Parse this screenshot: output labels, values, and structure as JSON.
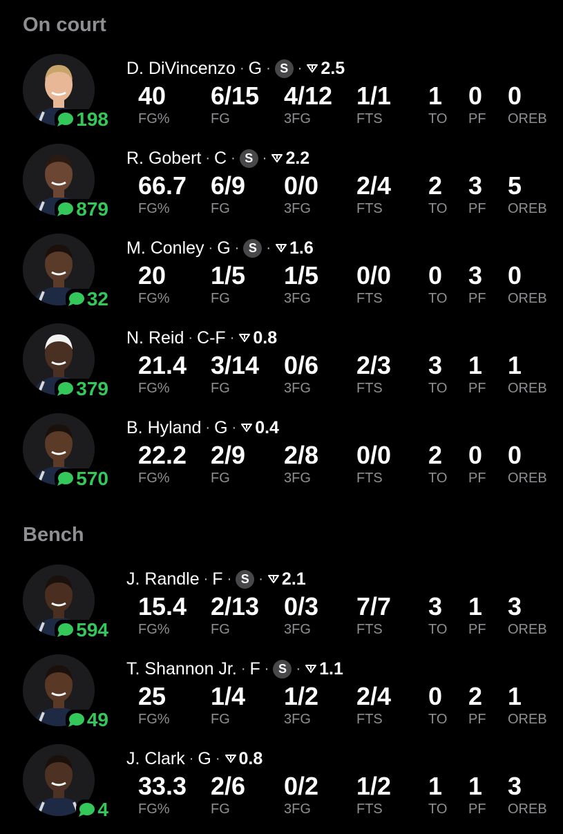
{
  "sections": {
    "on_court": "On court",
    "bench": "Bench"
  },
  "stat_labels": {
    "fg_pct": "FG%",
    "fg": "FG",
    "three_fg": "3FG",
    "fts": "FTS",
    "to": "TO",
    "pf": "PF",
    "oreb": "OREB"
  },
  "colors": {
    "background": "#000000",
    "comment_green": "#34c759",
    "label_gray": "#8e8e93"
  },
  "icons": {
    "comment": "speech-bubble-icon",
    "trend": "down-triangle-icon",
    "s_badge": "s-badge-icon"
  },
  "players": [
    {
      "name": "D. DiVincenzo",
      "pos": "G",
      "s_badge": "S",
      "rating": "2.5",
      "comments": "198",
      "fg_pct": "40",
      "fg": "6/15",
      "three_fg": "4/12",
      "fts": "1/1",
      "to": "1",
      "pf": "0",
      "oreb": "0"
    },
    {
      "name": "R. Gobert",
      "pos": "C",
      "s_badge": "S",
      "rating": "2.2",
      "comments": "879",
      "fg_pct": "66.7",
      "fg": "6/9",
      "three_fg": "0/0",
      "fts": "2/4",
      "to": "2",
      "pf": "3",
      "oreb": "5"
    },
    {
      "name": "M. Conley",
      "pos": "G",
      "s_badge": "S",
      "rating": "1.6",
      "comments": "32",
      "fg_pct": "20",
      "fg": "1/5",
      "three_fg": "1/5",
      "fts": "0/0",
      "to": "0",
      "pf": "3",
      "oreb": "0"
    },
    {
      "name": "N. Reid",
      "pos": "C-F",
      "s_badge": "",
      "rating": "0.8",
      "comments": "379",
      "fg_pct": "21.4",
      "fg": "3/14",
      "three_fg": "0/6",
      "fts": "2/3",
      "to": "3",
      "pf": "1",
      "oreb": "1"
    },
    {
      "name": "B. Hyland",
      "pos": "G",
      "s_badge": "",
      "rating": "0.4",
      "comments": "570",
      "fg_pct": "22.2",
      "fg": "2/9",
      "three_fg": "2/8",
      "fts": "0/0",
      "to": "2",
      "pf": "0",
      "oreb": "0"
    },
    {
      "name": "J. Randle",
      "pos": "F",
      "s_badge": "S",
      "rating": "2.1",
      "comments": "594",
      "fg_pct": "15.4",
      "fg": "2/13",
      "three_fg": "0/3",
      "fts": "7/7",
      "to": "3",
      "pf": "1",
      "oreb": "3"
    },
    {
      "name": "T. Shannon Jr.",
      "pos": "F",
      "s_badge": "S",
      "rating": "1.1",
      "comments": "49",
      "fg_pct": "25",
      "fg": "1/4",
      "three_fg": "1/2",
      "fts": "2/4",
      "to": "0",
      "pf": "2",
      "oreb": "1"
    },
    {
      "name": "J. Clark",
      "pos": "G",
      "s_badge": "",
      "rating": "0.8",
      "comments": "4",
      "fg_pct": "33.3",
      "fg": "2/6",
      "three_fg": "0/2",
      "fts": "1/2",
      "to": "1",
      "pf": "1",
      "oreb": "3"
    }
  ]
}
